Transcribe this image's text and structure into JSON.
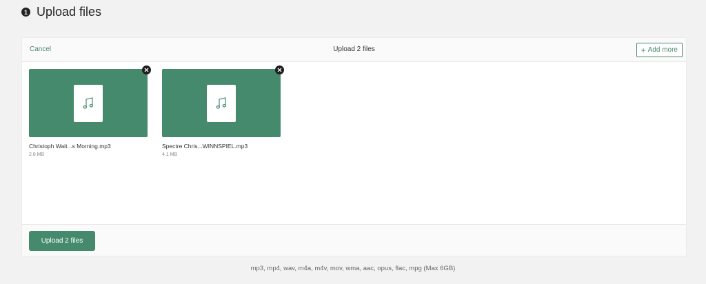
{
  "step": {
    "number": "1",
    "title": "Upload files"
  },
  "dashboard": {
    "cancel_label": "Cancel",
    "title": "Upload 2 files",
    "add_more_label": "Add more",
    "files": [
      {
        "name": "Christoph Wait...s Morning.mp3",
        "size": "2.8 MB",
        "icon": "music-note-icon"
      },
      {
        "name": "Spectre Chris...WINNSPIEL.mp3",
        "size": "4.1 MB",
        "icon": "music-note-icon"
      }
    ],
    "upload_button_label": "Upload 2 files"
  },
  "formats_note": "mp3, mp4, wav, m4a, m4v, mov, wma, aac, opus, flac, mpg (Max 6GB)",
  "colors": {
    "accent": "#458a6d",
    "accent_text": "#4c8a6e",
    "remove_badge": "#1e1e1e"
  }
}
